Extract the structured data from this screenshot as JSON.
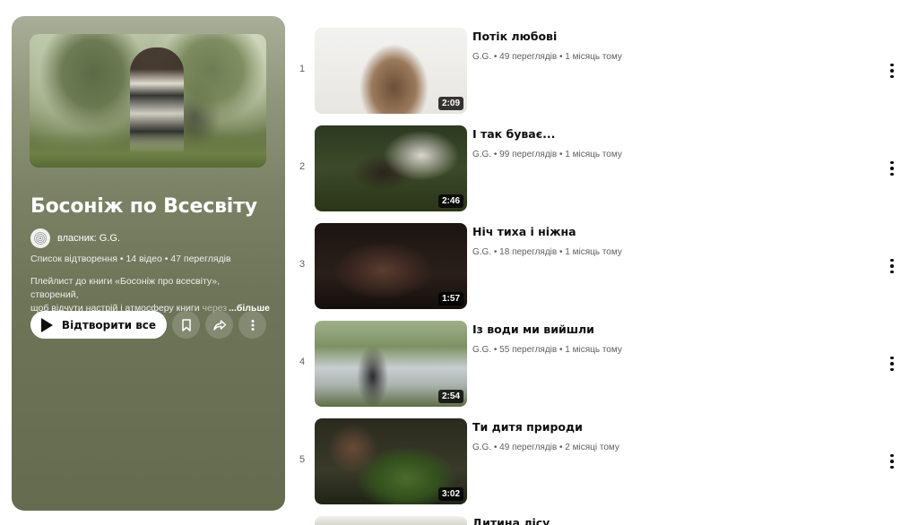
{
  "playlist": {
    "title": "Босоніж по Всесвіту",
    "owner_label": "власник: G.G.",
    "meta": "Список відтворення • 14 відео • 47 переглядів",
    "description_line1": "Плейлист до книги «Босоніж про всесвіту», створений,",
    "description_line2": "щоб відчути настрій і атмосферу книги",
    "description_fade": "через",
    "more_label": "...більше",
    "play_all_label": "Відтворити все",
    "bg_color": "#6f7559"
  },
  "videos": [
    {
      "index": "1",
      "title": "Потік любові",
      "meta": "G.G. • 49 переглядів • 1 місяць тому",
      "duration": "2:09"
    },
    {
      "index": "2",
      "title": "І так буває...",
      "meta": "G.G. • 99 переглядів • 1 місяць тому",
      "duration": "2:46"
    },
    {
      "index": "3",
      "title": "Ніч тиха і ніжна",
      "meta": "G.G. • 18 переглядів • 1 місяць тому",
      "duration": "1:57"
    },
    {
      "index": "4",
      "title": "Із води ми вийшли",
      "meta": "G.G. • 55 переглядів • 1 місяць тому",
      "duration": "2:54"
    },
    {
      "index": "5",
      "title": "Ти дитя природи",
      "meta": "G.G. • 49 переглядів • 2 місяці тому",
      "duration": "3:02"
    },
    {
      "index": "6",
      "title": "Дитина лісу",
      "meta": "",
      "duration": ""
    }
  ],
  "icons": {
    "play": "play-icon",
    "save": "bookmark-icon",
    "share": "share-icon",
    "more": "more-vert-icon",
    "owner": "spiral-avatar-icon"
  }
}
